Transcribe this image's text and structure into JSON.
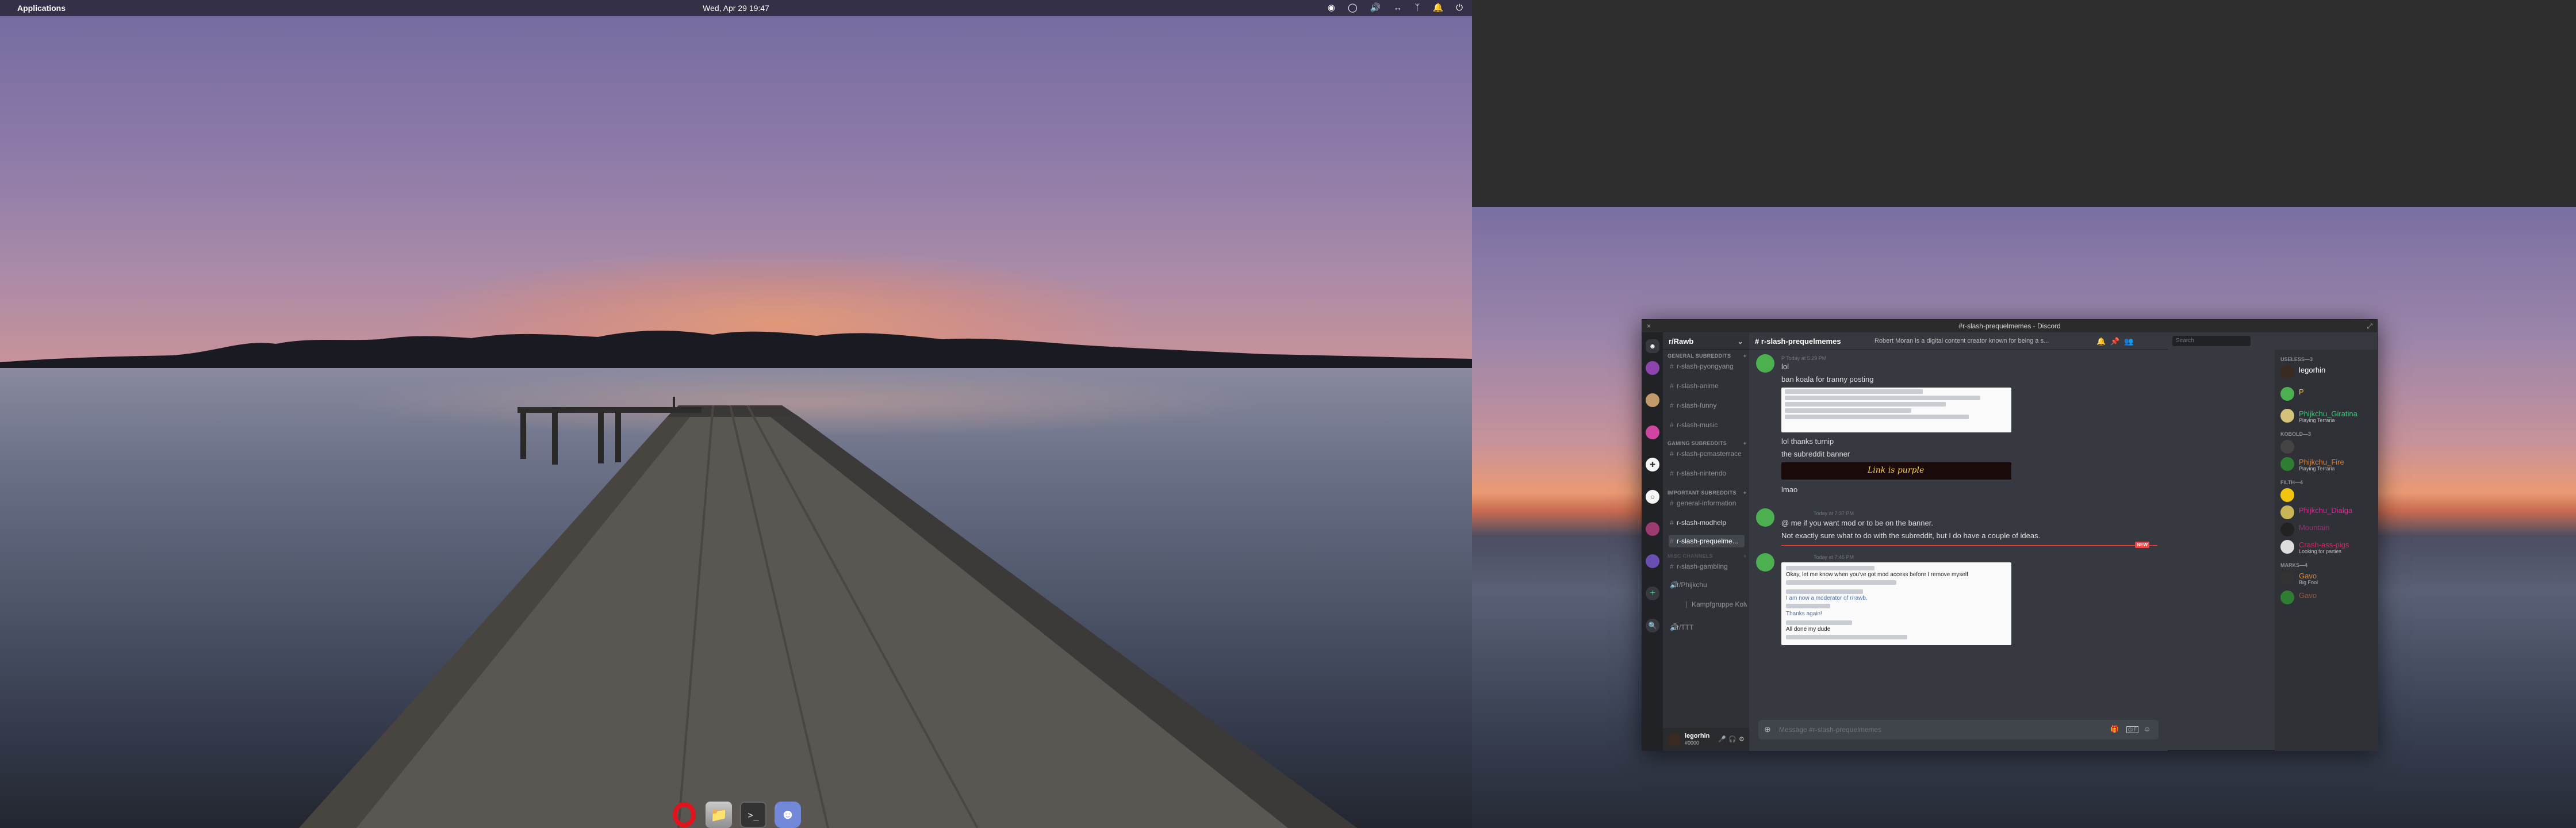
{
  "top_panel": {
    "applications_label": "Applications",
    "clock": "Wed, Apr 29  19:47",
    "tray_icons": [
      "discord-icon",
      "steam-icon",
      "volume-icon",
      "network-icon",
      "bluetooth-icon",
      "notifications-icon",
      "power-icon"
    ]
  },
  "dock": {
    "apps": [
      "opera-browser",
      "files",
      "terminal",
      "discord"
    ],
    "terminal_glyph": ">_"
  },
  "discord": {
    "window_title": "#r-slash-prequelmemes - Discord",
    "server_name": "r/Rawb",
    "channel_header": "r-slash-prequelmemes",
    "topic": "Robert Moran is a digital content creator known for being a s...",
    "search_placeholder": "Search",
    "categories": {
      "general": "GENERAL SUBREDDITS",
      "gaming": "GAMING SUBREDDITS",
      "important": "IMPORTANT SUBREDDITS",
      "other": "MISC CHANNELS"
    },
    "channels": [
      "r-slash-pyongyang",
      "r-slash-anime",
      "r-slash-funny",
      "r-slash-music",
      "r-slash-pcmasterrace",
      "r-slash-nintendo",
      "general-information",
      "r-slash-modhelp",
      "r-slash-prequelme...",
      "r-slash-gambling",
      "r/Phijkchu",
      "Kampfgruppe Kolwadi",
      "r/TTT"
    ],
    "user": {
      "name": "legorhin",
      "discriminator": "#0000"
    },
    "messages": {
      "group1_meta": "P  Today at 5:29 PM",
      "group1_lines": [
        "lol",
        "ban koala for tranny posting"
      ],
      "group1_lines2": [
        "lol thanks turnip",
        "the subreddit banner"
      ],
      "group1_line3": "lmao",
      "banner_text": "Link is purple",
      "group2_meta": "Today at 7:37 PM",
      "group2_lines": [
        "@ me if you want mod or to be on the banner.",
        "Not exactly sure what to do with the subreddit, but I do have a couple of ideas."
      ],
      "new_label": "NEW",
      "group3_meta": "Today at 7:46 PM",
      "embed2_lines": [
        "Okay, let me know when you've got mod access before I remove myself",
        "I am now a moderator of r/rawb.",
        "Thanks again!",
        "All done my dude"
      ]
    },
    "composer_placeholder": "Message #r-slash-prequelmemes",
    "member_categories": {
      "c1": "USELESS—3",
      "c2": "KOBOLD—3",
      "c3": "FILTH—4",
      "c4": "MARKS—4"
    },
    "members": [
      {
        "name": "legorhin",
        "status": "",
        "color": "#ffffff"
      },
      {
        "name": "P",
        "status": "",
        "color": "#f1c40f"
      },
      {
        "name": "Phijkchu_Giratina",
        "status": "Playing Terraria",
        "color": "#2ecc71"
      },
      {
        "name": "Phijkchu_Fire",
        "status": "Playing Terraria",
        "color": "#e67e22"
      },
      {
        "name": "Phijkchu_Dialga",
        "status": "",
        "color": "#e91e9c"
      },
      {
        "name": "Mountain",
        "status": "",
        "color": "#e91e9c"
      },
      {
        "name": "Crash-ass-pigs",
        "status": "Looking for parties",
        "color": "#e91e63"
      },
      {
        "name": "Gavo",
        "status": "Big Fool",
        "color": "#e67e22"
      },
      {
        "name": "Gavo",
        "status": "",
        "color": "#e67e22"
      }
    ],
    "colors": {
      "blurple": "#7289da",
      "mention_red": "#f04747",
      "online": "#43b581"
    }
  }
}
